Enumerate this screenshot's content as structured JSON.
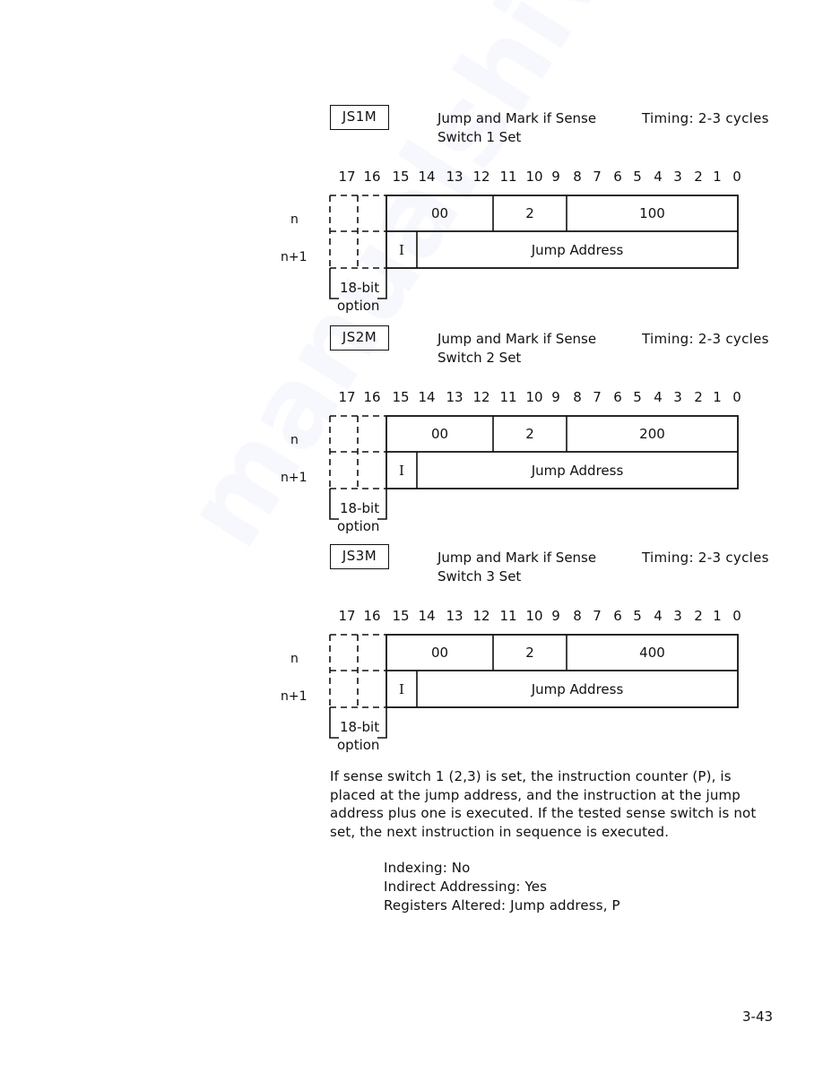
{
  "watermark": "manualshive.com",
  "instructions": [
    {
      "mnemonic": "JS1M",
      "description_line1": "Jump and Mark if Sense",
      "description_line2": "Switch 1 Set",
      "timing": "Timing: 2-3 cycles",
      "bit_numbers": [
        "17",
        "16",
        "15",
        "14",
        "13",
        "12",
        "11",
        "10",
        "9",
        "8",
        "7",
        "6",
        "5",
        "4",
        "3",
        "2",
        "1",
        "0"
      ],
      "row_labels": [
        "n",
        "n+1"
      ],
      "word_n": {
        "opcode": "00",
        "group": "2",
        "function": "100"
      },
      "word_n1": {
        "indirect": "I",
        "address": "Jump Address"
      },
      "option_label_line1": "18-bit",
      "option_label_line2": "option"
    },
    {
      "mnemonic": "JS2M",
      "description_line1": "Jump and Mark if Sense",
      "description_line2": "Switch 2 Set",
      "timing": "Timing: 2-3 cycles",
      "bit_numbers": [
        "17",
        "16",
        "15",
        "14",
        "13",
        "12",
        "11",
        "10",
        "9",
        "8",
        "7",
        "6",
        "5",
        "4",
        "3",
        "2",
        "1",
        "0"
      ],
      "row_labels": [
        "n",
        "n+1"
      ],
      "word_n": {
        "opcode": "00",
        "group": "2",
        "function": "200"
      },
      "word_n1": {
        "indirect": "I",
        "address": "Jump Address"
      },
      "option_label_line1": "18-bit",
      "option_label_line2": "option"
    },
    {
      "mnemonic": "JS3M",
      "description_line1": "Jump and Mark if Sense",
      "description_line2": "Switch 3 Set",
      "timing": "Timing: 2-3 cycles",
      "bit_numbers": [
        "17",
        "16",
        "15",
        "14",
        "13",
        "12",
        "11",
        "10",
        "9",
        "8",
        "7",
        "6",
        "5",
        "4",
        "3",
        "2",
        "1",
        "0"
      ],
      "row_labels": [
        "n",
        "n+1"
      ],
      "word_n": {
        "opcode": "00",
        "group": "2",
        "function": "400"
      },
      "word_n1": {
        "indirect": "I",
        "address": "Jump Address"
      },
      "option_label_line1": "18-bit",
      "option_label_line2": "option"
    }
  ],
  "description_paragraph": [
    "If sense switch 1 (2,3) is set, the instruction counter (P), is",
    "placed at the jump address, and the instruction at the jump",
    "address plus one is executed.  If the tested sense switch is not",
    "set, the next instruction in sequence is executed."
  ],
  "properties": [
    "Indexing:  No",
    "Indirect Addressing:  Yes",
    "Registers Altered:  Jump address, P"
  ],
  "page_number": "3-43"
}
